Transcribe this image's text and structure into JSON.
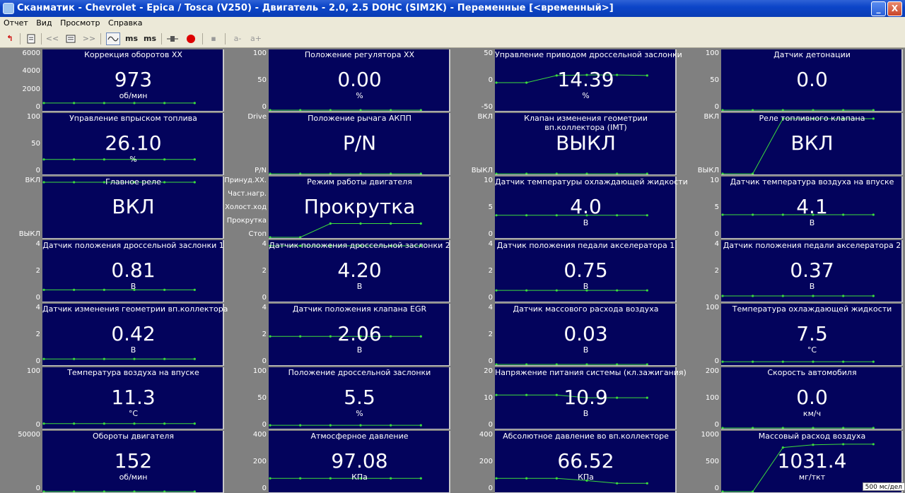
{
  "window": {
    "title": "Сканматик - Chevrolet - Epica / Tosca (V250) - Двигатель - 2.0, 2.5 DOHC (SIM2K) - Переменные [<временный>]",
    "buttons": {
      "minimize": "_",
      "maximize": "□",
      "close": "X"
    }
  },
  "menu": [
    "Отчет",
    "Вид",
    "Просмотр",
    "Справка"
  ],
  "toolbar": {
    "icons": [
      "exit-arrow-icon",
      "report-icon",
      "back-icon",
      "list-icon",
      "forward-icon",
      "graph-mode-icon",
      "ms-down-icon",
      "ms-up-icon",
      "connector-icon",
      "record-icon",
      "save-icon",
      "font-down-icon",
      "font-up-icon"
    ],
    "labels": {
      "back": "<<",
      "forward": ">>",
      "ms_down": "ms",
      "ms_up": "ms",
      "font_down": "a-",
      "font_up": "a+"
    },
    "colors": {
      "exit": "#cc0000",
      "record": "#dd0000"
    }
  },
  "trace_color": "#3cdc3c",
  "panels": [
    {
      "title": "Коррекция оборотов ХХ",
      "value": "973",
      "unit": "об/мин",
      "yticks": [
        "6000",
        "4000",
        "2000",
        "0"
      ],
      "trace": [
        0.13,
        0.13,
        0.13,
        0.13,
        0.13,
        0.13
      ]
    },
    {
      "title": "Положение регулятора ХХ",
      "value": "0.00",
      "unit": "%",
      "yticks": [
        "100",
        "50",
        "0"
      ],
      "trace": [
        0.0,
        0.0,
        0.0,
        0.0,
        0.0,
        0.0
      ]
    },
    {
      "title": "Управление приводом дроссельной заслонки",
      "value": "14.39",
      "unit": "%",
      "yticks": [
        "50",
        "0",
        "-50"
      ],
      "trace": [
        0.5,
        0.5,
        0.63,
        0.64,
        0.64,
        0.63
      ]
    },
    {
      "title": "Датчик детонации",
      "value": "0.0",
      "unit": "",
      "yticks": [
        "100",
        "50",
        "0"
      ],
      "trace": [
        0.0,
        0.0,
        0.0,
        0.0,
        0.0,
        0.0
      ]
    },
    {
      "title": "Управление впрыском топлива",
      "value": "26.10",
      "unit": "%",
      "yticks": [
        "100",
        "50",
        "0"
      ],
      "trace": [
        0.26,
        0.26,
        0.26,
        0.26,
        0.26,
        0.26
      ]
    },
    {
      "title": "Положение рычага АКПП",
      "value": "P/N",
      "unit": "",
      "yticks": [
        "Drive",
        "P/N"
      ],
      "trace": [
        0.0,
        0.0,
        0.0,
        0.0,
        0.0,
        0.0
      ]
    },
    {
      "title": "Клапан изменения геометрии вп.коллектора (IMT)",
      "value": "ВЫКЛ",
      "unit": "",
      "yticks": [
        "ВКЛ",
        "ВЫКЛ"
      ],
      "trace": [
        0.0,
        0.0,
        0.0,
        0.0,
        0.0,
        0.0
      ]
    },
    {
      "title": "Реле топливного клапана",
      "value": "ВКЛ",
      "unit": "",
      "yticks": [
        "ВКЛ",
        "ВЫКЛ"
      ],
      "trace": [
        0.0,
        0.0,
        1.0,
        1.0,
        1.0,
        1.0
      ]
    },
    {
      "title": "Главное реле",
      "value": "ВКЛ",
      "unit": "",
      "yticks": [
        "ВКЛ",
        "ВЫКЛ"
      ],
      "trace": [
        1.0,
        1.0,
        1.0,
        1.0,
        1.0,
        1.0
      ]
    },
    {
      "title": "Режим работы двигателя",
      "value": "Прокрутка",
      "unit": "",
      "yticks": [
        "Принуд.ХХ.",
        "Част.нагр.",
        "Холост.ход",
        "Прокрутка",
        "Стоп"
      ],
      "trace": [
        0.0,
        0.0,
        0.25,
        0.25,
        0.25,
        0.25
      ]
    },
    {
      "title": "Датчик температуры охлаждающей жидкости",
      "value": "4.0",
      "unit": "В",
      "yticks": [
        "10",
        "5",
        "0"
      ],
      "trace": [
        0.4,
        0.4,
        0.4,
        0.4,
        0.4,
        0.4
      ]
    },
    {
      "title": "Датчик температура воздуха на впуске",
      "value": "4.1",
      "unit": "В",
      "yticks": [
        "10",
        "5",
        "0"
      ],
      "trace": [
        0.41,
        0.41,
        0.41,
        0.41,
        0.41,
        0.41
      ]
    },
    {
      "title": "Датчик положения дроссельной заслонки 1",
      "value": "0.81",
      "unit": "В",
      "yticks": [
        "4",
        "2",
        "0"
      ],
      "trace": [
        0.2,
        0.2,
        0.2,
        0.2,
        0.2,
        0.2
      ]
    },
    {
      "title": "Датчик положения дроссельной заслонки 2",
      "value": "4.20",
      "unit": "В",
      "yticks": [
        "4",
        "2",
        "0"
      ],
      "trace": [
        1.0,
        1.0,
        1.0,
        1.0,
        1.0,
        1.0
      ]
    },
    {
      "title": "Датчик положения педали акселератора 1",
      "value": "0.75",
      "unit": "В",
      "yticks": [
        "4",
        "2",
        "0"
      ],
      "trace": [
        0.19,
        0.19,
        0.19,
        0.19,
        0.19,
        0.19
      ]
    },
    {
      "title": "Датчик положения педали акселератора 2",
      "value": "0.37",
      "unit": "В",
      "yticks": [
        "4",
        "2",
        "0"
      ],
      "trace": [
        0.09,
        0.09,
        0.09,
        0.09,
        0.09,
        0.09
      ]
    },
    {
      "title": "Датчик изменения геометрии вп.коллектора",
      "value": "0.42",
      "unit": "В",
      "yticks": [
        "4",
        "2",
        "0"
      ],
      "trace": [
        0.1,
        0.1,
        0.1,
        0.1,
        0.1,
        0.1
      ]
    },
    {
      "title": "Датчик положения клапана EGR",
      "value": "2.06",
      "unit": "В",
      "yticks": [
        "4",
        "2",
        "0"
      ],
      "trace": [
        0.51,
        0.51,
        0.51,
        0.51,
        0.51,
        0.51
      ]
    },
    {
      "title": "Датчик массового расхода воздуха",
      "value": "0.03",
      "unit": "В",
      "yticks": [
        "4",
        "2",
        "0"
      ],
      "trace": [
        0.0,
        0.0,
        0.0,
        0.0,
        0.0,
        0.0
      ]
    },
    {
      "title": "Температура охлаждающей жидкости",
      "value": "7.5",
      "unit": "°С",
      "yticks": [
        "100",
        "0"
      ],
      "trace": [
        0.05,
        0.05,
        0.05,
        0.05,
        0.05,
        0.05
      ]
    },
    {
      "title": "Температура воздуха на впуске",
      "value": "11.3",
      "unit": "°С",
      "yticks": [
        "100",
        "0"
      ],
      "trace": [
        0.08,
        0.08,
        0.08,
        0.08,
        0.08,
        0.08
      ]
    },
    {
      "title": "Положение дроссельной заслонки",
      "value": "5.5",
      "unit": "%",
      "yticks": [
        "100",
        "50",
        "0"
      ],
      "trace": [
        0.05,
        0.05,
        0.05,
        0.05,
        0.05,
        0.05
      ]
    },
    {
      "title": "Напряжение питания системы (кл.зажигания)",
      "value": "10.9",
      "unit": "В",
      "yticks": [
        "20",
        "10",
        "0"
      ],
      "trace": [
        0.6,
        0.6,
        0.6,
        0.55,
        0.55,
        0.55
      ]
    },
    {
      "title": "Скорость автомобиля",
      "value": "0.0",
      "unit": "км/ч",
      "yticks": [
        "200",
        "100",
        "0"
      ],
      "trace": [
        0.0,
        0.0,
        0.0,
        0.0,
        0.0,
        0.0
      ]
    },
    {
      "title": "Обороты двигателя",
      "value": "152",
      "unit": "об/мин",
      "yticks": [
        "50000",
        "0"
      ],
      "trace": [
        0.0,
        0.0,
        0.0,
        0.0,
        0.0,
        0.0
      ]
    },
    {
      "title": "Атмосферное давление",
      "value": "97.08",
      "unit": "КПа",
      "yticks": [
        "400",
        "200",
        "0"
      ],
      "trace": [
        0.24,
        0.24,
        0.24,
        0.24,
        0.24,
        0.24
      ]
    },
    {
      "title": "Абсолютное давление во вп.коллекторе",
      "value": "66.52",
      "unit": "КПа",
      "yticks": [
        "400",
        "200",
        "0"
      ],
      "trace": [
        0.24,
        0.24,
        0.24,
        0.2,
        0.15,
        0.15
      ]
    },
    {
      "title": "Массовый расход воздуха",
      "value": "1031.4",
      "unit": "мг/ткт",
      "yticks": [
        "1000",
        "500",
        "0"
      ],
      "trace": [
        0.0,
        0.0,
        0.8,
        0.85,
        0.86,
        0.86
      ]
    }
  ],
  "time_scale": "500 мс/дел"
}
